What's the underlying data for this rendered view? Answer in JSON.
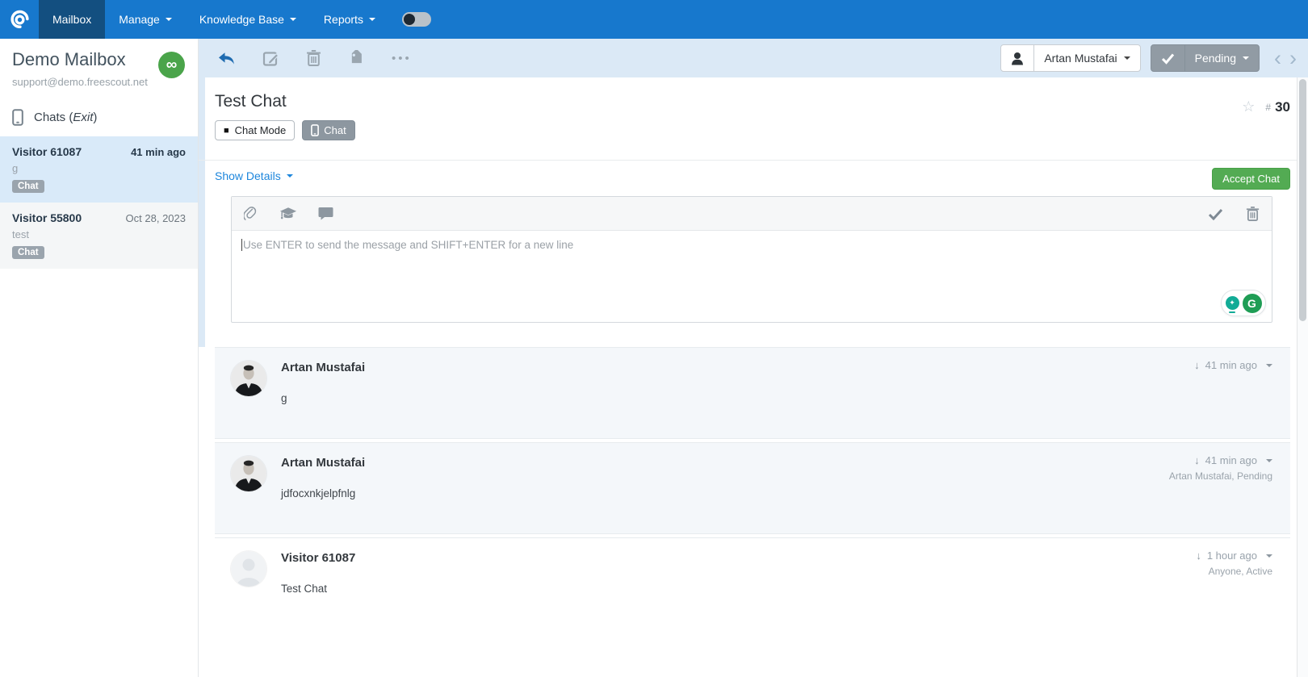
{
  "colors": {
    "navbar_blue": "#1778cd",
    "active_tab_blue": "#134f80",
    "toolbar_light_blue": "#dbe9f6",
    "link_blue": "#1d86dc",
    "accept_green": "#53ab53",
    "mailbox_badge_green": "#4aa44a",
    "status_gray": "#919ba4",
    "badge_gray": "#9aa4ad",
    "grammarly_green": "#1f9d55",
    "grammarly_teal": "#12ab96"
  },
  "icons": {
    "ellipsis": "•••",
    "prev": "‹",
    "next": "›",
    "star": "☆",
    "down_arrow": "↓",
    "infinity": "∞",
    "chat_mode_square": "■",
    "bulb_star": "✦",
    "grammarly_g": "G"
  },
  "navbar": {
    "items": [
      {
        "label": "Mailbox"
      },
      {
        "label": "Manage"
      },
      {
        "label": "Knowledge Base"
      },
      {
        "label": "Reports"
      }
    ]
  },
  "sidebar": {
    "mailbox_name": "Demo Mailbox",
    "mailbox_email": "support@demo.freescout.net",
    "chats_prefix": "Chats (",
    "chats_exit": "Exit",
    "chats_suffix": ")",
    "conversations": [
      {
        "name": "Visitor 61087",
        "time": "41 min ago",
        "preview": "g",
        "badge": "Chat"
      },
      {
        "name": "Visitor 55800",
        "time": "Oct 28, 2023",
        "preview": "test",
        "badge": "Chat"
      }
    ]
  },
  "toolbar": {
    "assignee": "Artan Mustafai",
    "status": "Pending"
  },
  "conversation": {
    "title": "Test Chat",
    "number_hash": "#",
    "number": "30",
    "chat_mode_label": "Chat Mode",
    "chat_label": "Chat",
    "show_details_label": "Show Details",
    "accept_chat_label": "Accept Chat"
  },
  "editor": {
    "placeholder": "Use ENTER to send the message and SHIFT+ENTER for a new line"
  },
  "thread": {
    "messages": [
      {
        "author": "Artan Mustafai",
        "time": "41 min ago",
        "body": "g",
        "meta2": ""
      },
      {
        "author": "Artan Mustafai",
        "time": "41 min ago",
        "body": "jdfocxnkjelpfnlg",
        "meta2": "Artan Mustafai, Pending"
      },
      {
        "author": "Visitor 61087",
        "time": "1 hour ago",
        "body": "Test Chat",
        "meta2": "Anyone, Active"
      }
    ]
  }
}
